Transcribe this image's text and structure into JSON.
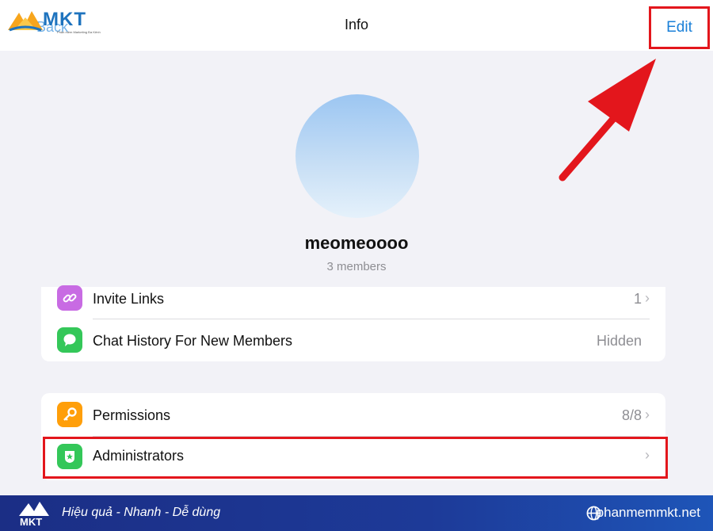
{
  "header": {
    "logo_text": "MKT",
    "logo_sub": "Phần mềm Marketing Đa Kênh",
    "back_label": "Back",
    "title": "Info",
    "edit_label": "Edit"
  },
  "profile": {
    "name": "meomeoooo",
    "members": "3 members"
  },
  "group1": {
    "items": [
      {
        "label": "Invite Links",
        "value": "1",
        "icon": "link-icon",
        "color": "#c86be3"
      },
      {
        "label": "Chat History For New Members",
        "value": "Hidden",
        "icon": "chat-bubble-icon",
        "color": "#34c759"
      }
    ]
  },
  "group2": {
    "items": [
      {
        "label": "Permissions",
        "value": "8/8",
        "icon": "key-icon",
        "color": "#ff9f0a"
      },
      {
        "label": "Administrators",
        "value": "",
        "icon": "badge-star-icon",
        "color": "#34c759"
      }
    ]
  },
  "footer": {
    "logo_text": "MKT",
    "slogan": "Hiệu quả - Nhanh  - Dễ dùng",
    "site": "phanmemmkt.net"
  },
  "colors": {
    "accent": "#1b80d8",
    "highlight": "#e3161c",
    "footer_bg": "#1d3a98"
  }
}
